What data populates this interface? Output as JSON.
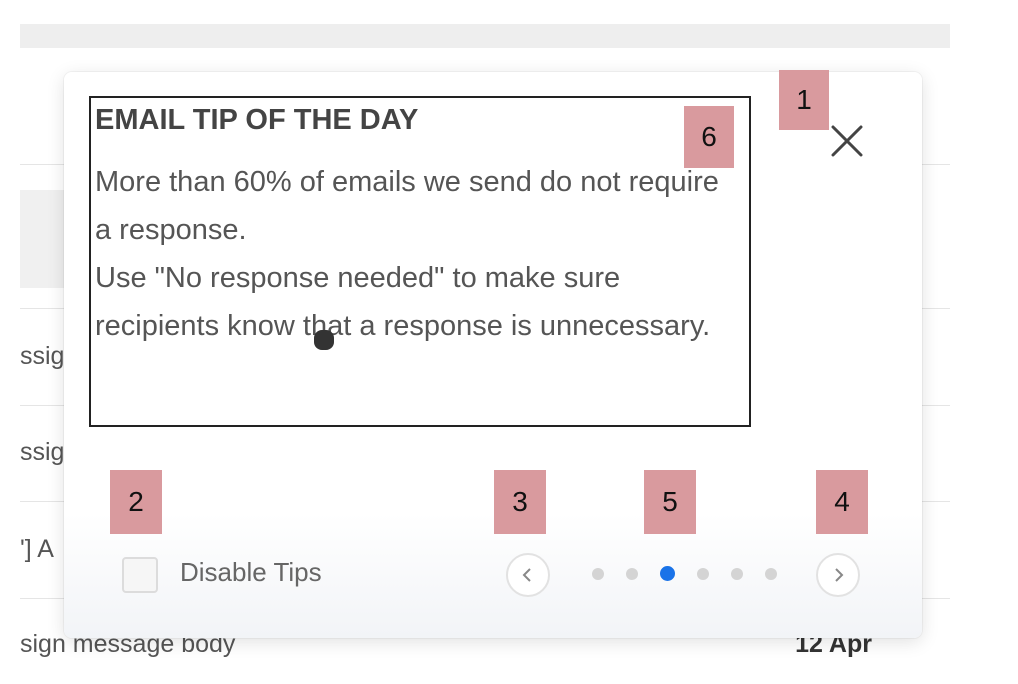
{
  "background": {
    "row_fragments": [
      "ssig",
      "ssig",
      "'] A",
      "sign message body"
    ],
    "date": "12 Apr"
  },
  "tip": {
    "title": "EMAIL TIP OF THE DAY",
    "line1": "More than 60% of emails we send do not require a response.",
    "line2": "Use \"No response needed\" to make sure recipients know that a response is unnecessary."
  },
  "controls": {
    "disable_label": "Disable Tips",
    "disable_checked": false,
    "dots_count": 6,
    "active_dot": 3
  },
  "badges": [
    "1",
    "2",
    "3",
    "4",
    "5",
    "6"
  ],
  "colors": {
    "accent": "#1a73e8",
    "badge": "#d99a9e"
  }
}
